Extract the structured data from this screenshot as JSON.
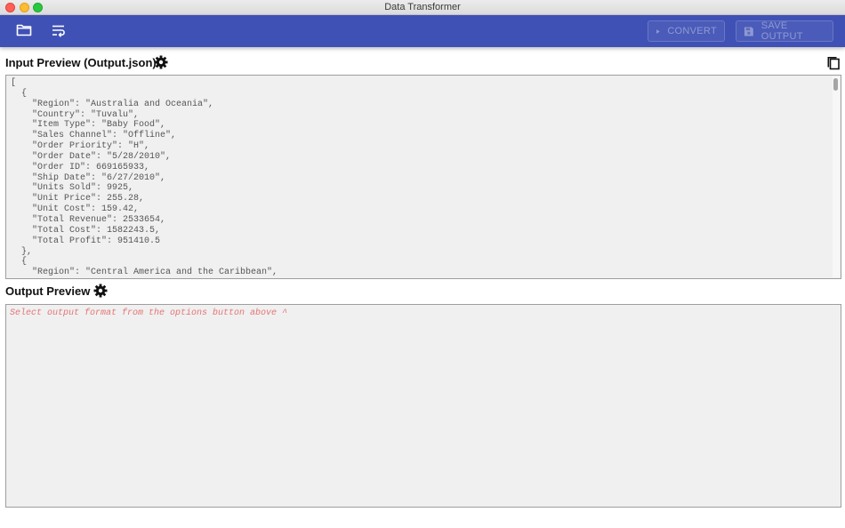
{
  "window": {
    "title": "Data Transformer"
  },
  "toolbar": {
    "open_icon": "folder-icon",
    "wrap_icon": "wrap-text-icon",
    "convert_label": "CONVERT",
    "save_label": "SAVE OUTPUT"
  },
  "input": {
    "title": "Input Preview (Output.json)",
    "lines": [
      "[",
      "  {",
      "    \"Region\": \"Australia and Oceania\",",
      "    \"Country\": \"Tuvalu\",",
      "    \"Item Type\": \"Baby Food\",",
      "    \"Sales Channel\": \"Offline\",",
      "    \"Order Priority\": \"H\",",
      "    \"Order Date\": \"5/28/2010\",",
      "    \"Order ID\": 669165933,",
      "    \"Ship Date\": \"6/27/2010\",",
      "    \"Units Sold\": 9925,",
      "    \"Unit Price\": 255.28,",
      "    \"Unit Cost\": 159.42,",
      "    \"Total Revenue\": 2533654,",
      "    \"Total Cost\": 1582243.5,",
      "    \"Total Profit\": 951410.5",
      "  },",
      "  {",
      "    \"Region\": \"Central America and the Caribbean\","
    ]
  },
  "output": {
    "title": "Output Preview",
    "placeholder": "Select output format from the options button above ^"
  },
  "colors": {
    "toolbar": "#3f51b5",
    "placeholder": "#e57373"
  }
}
